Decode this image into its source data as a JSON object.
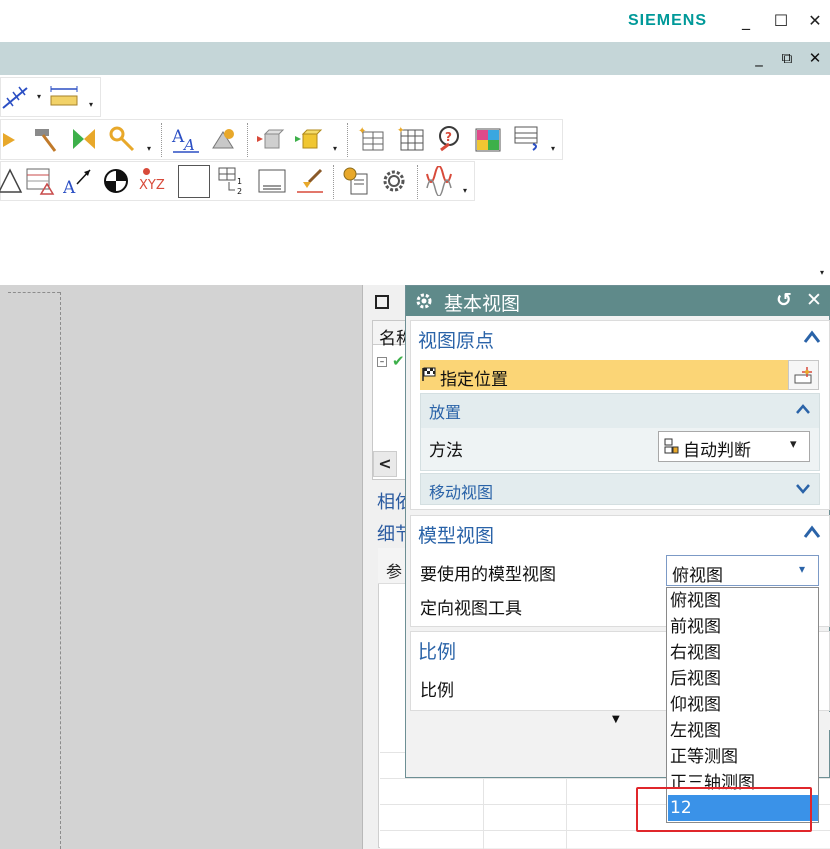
{
  "window": {
    "brand": "SIEMENS",
    "minimize_glyph": "_",
    "maximize_glyph": "☐",
    "close_glyph": "✕"
  },
  "doc_controls": {
    "minimize_glyph": "_",
    "restore_glyph": "⧉",
    "close_glyph": "✕"
  },
  "toolbar": {
    "icons_row0": [
      "dimension-chain-icon",
      "ruler-measure-icon"
    ],
    "icons_row1": [
      "arrow-partial-icon",
      "hammer-icon",
      "bowtie-icon",
      "wrench-joint-icon",
      "text-annotation-icon",
      "weld-icon",
      "block-arrow-icon",
      "cube-arrow-icon",
      "table-sparkle-icon",
      "table-grid-icon",
      "part-finder-icon",
      "table-colored-icon",
      "table-link-icon"
    ],
    "icons_row2": [
      "triangle-icon",
      "table-triangle-icon",
      "arrow-text-icon",
      "circle-half-icon",
      "xyz-point-icon",
      "blank-square-icon",
      "table-numbered-icon",
      "text-box-icon",
      "brush-arrow-icon",
      "gear-doc-icon",
      "gear-icon",
      "wave-icon"
    ],
    "xyz_label": "XYZ"
  },
  "navigator": {
    "header_fragment": "名称",
    "related_fragment": "相依",
    "details_fragment": "细节",
    "param_fragment": "参",
    "scroll_left_glyph": "<"
  },
  "dialog": {
    "title": "基本视图",
    "reset_glyph": "↺",
    "close_glyph": "✕",
    "section_origin": {
      "title": "视图原点",
      "collapse_glyph": "^",
      "specify_location": "指定位置",
      "placement": {
        "title": "放置",
        "collapse_glyph": "^",
        "method_label": "方法",
        "method_value": "自动判断",
        "dropdown_glyph": "▾"
      },
      "move_view": {
        "title": "移动视图",
        "expand_glyph": "v"
      }
    },
    "section_model": {
      "title": "模型视图",
      "collapse_glyph": "^",
      "model_view_label": "要使用的模型视图",
      "model_view_value": "俯视图",
      "orient_tool_label": "定向视图工具",
      "dropdown_glyph": "▾"
    },
    "section_scale": {
      "title": "比例",
      "scale_label": "比例"
    },
    "more_glyph": "▼"
  },
  "dropdown": {
    "options": [
      "俯视图",
      "前视图",
      "右视图",
      "后视图",
      "仰视图",
      "左视图",
      "正等测图",
      "正三轴测图"
    ],
    "selected": "12",
    "highlight_color": "#e0262b",
    "selection_color": "#3a92e8"
  }
}
